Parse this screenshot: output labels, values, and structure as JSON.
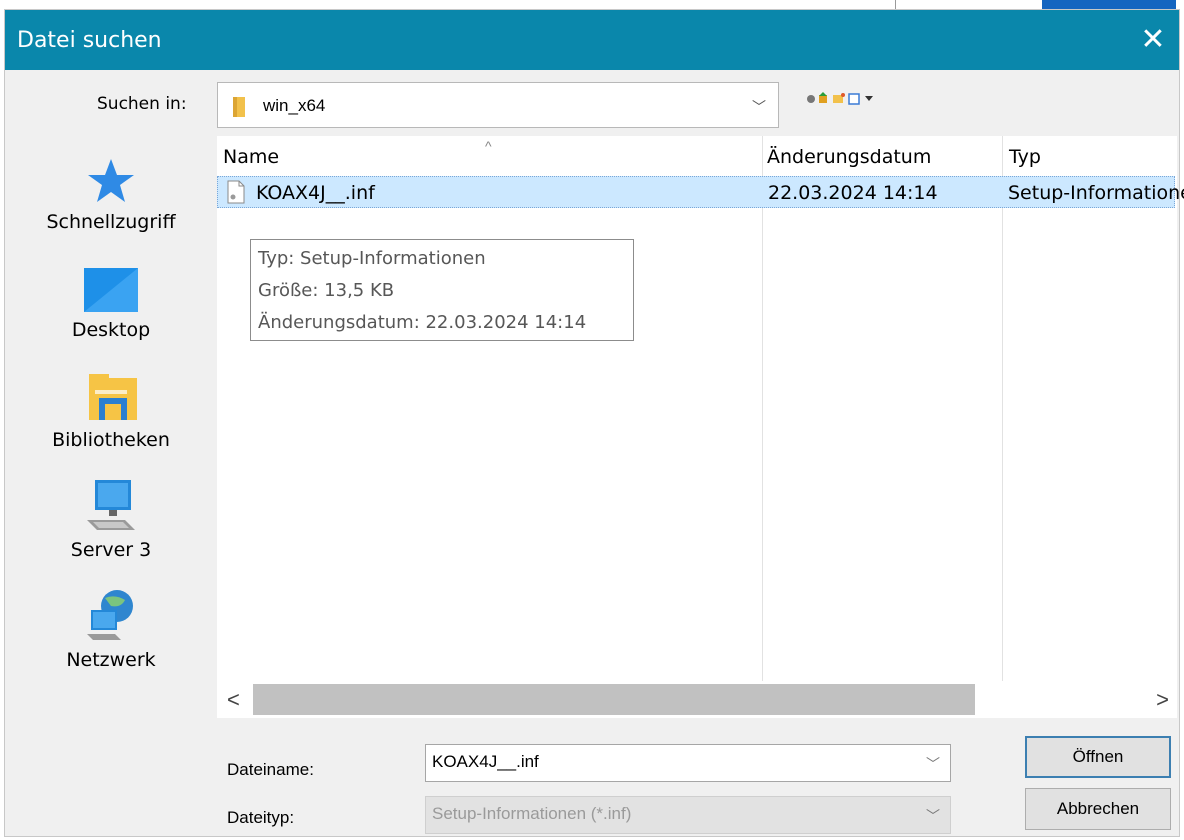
{
  "dialog": {
    "title": "Datei suchen",
    "close_glyph": "✕"
  },
  "lookin": {
    "label": "Suchen in:",
    "value": "win_x64",
    "chevron": "﹀"
  },
  "places": [
    {
      "label": "Schnellzugriff",
      "icon": "star-icon"
    },
    {
      "label": "Desktop",
      "icon": "desktop-icon"
    },
    {
      "label": "Bibliotheken",
      "icon": "libraries-icon"
    },
    {
      "label": "Server 3",
      "icon": "computer-icon"
    },
    {
      "label": "Netzwerk",
      "icon": "network-icon"
    }
  ],
  "list": {
    "columns": [
      "Name",
      "Änderungsdatum",
      "Typ"
    ],
    "sort_glyph": "^",
    "rows": [
      {
        "name": "KOAX4J__.inf",
        "date": "22.03.2024 14:14",
        "type": "Setup-Informationen"
      }
    ]
  },
  "tooltip": {
    "type": "Typ: Setup-Informationen",
    "size": "Größe: 13,5 KB",
    "date": "Änderungsdatum: 22.03.2024 14:14"
  },
  "scroll": {
    "left": "<",
    "right": ">"
  },
  "filename": {
    "label": "Dateiname:",
    "value": "KOAX4J__.inf"
  },
  "filetype": {
    "label": "Dateityp:",
    "value": "Setup-Informationen (*.inf)"
  },
  "buttons": {
    "open": "Öffnen",
    "cancel": "Abbrechen"
  },
  "colors": {
    "titlebar": "#0a87ab",
    "selection": "#cce8ff",
    "accent": "#1565c0"
  }
}
